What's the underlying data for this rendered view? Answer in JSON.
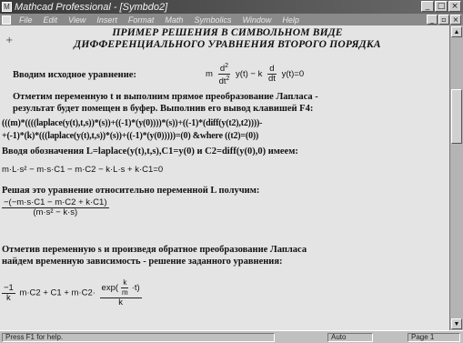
{
  "window": {
    "title": "Mathcad Professional - [Symbdo2]"
  },
  "menubar": {
    "items": [
      "File",
      "Edit",
      "View",
      "Insert",
      "Format",
      "Math",
      "Symbolics",
      "Window",
      "Help"
    ]
  },
  "document": {
    "heading_1": "ПРИМЕР РЕШЕНИЯ В СИМВОЛЬНОМ ВИДЕ",
    "heading_2": "ДИФФЕРЕНЦИАЛЬНОГО УРАВНЕНИЯ ВТОРОГО ПОРЯДКА",
    "input_label": "Вводим исходное уравнение:",
    "equation": {
      "m": "m",
      "d2": "d",
      "sq": "2",
      "dt2": "dt",
      "yt": "y(t)",
      "minus_k": "− k",
      "d1": "d",
      "dt1": "dt",
      "yt2": "y(t)",
      "eq": "=0"
    },
    "para_1a": "Отметим переменную t и выполним прямое преобразование Лапласа -",
    "para_1b": "результат будет помещен в буфер. Выполнив его вывод клавишей F4:",
    "laplace_1": "(((m)*((((laplace(y(t),t,s))*(s))+((-1)*(y(0))))*(s))+((-1)*(diff(y(t2),t2))))-",
    "laplace_2": "+(-1)*(k)*(((laplace(y(t),t,s))*(s))+((-1)*(y(0)))))=(0) &where ((t2)=(0))",
    "para_2": "Вводя обозначения L=laplace(y(t),t,s),C1=y(0) и C2=diff(y(0),0) имеем:",
    "expr_1": "m·L·s² − m·s·C1 − m·C2 − k·L·s + k·C1=0",
    "para_3": "Решая это уравнение относительно переменной L получим:",
    "sol_num": "−(−m·s·C1 − m·C2 + k·C1)",
    "sol_den": "(m·s² − k·s)",
    "para_4a": "Отметив переменную s и произведя обратное преобразование Лапласа",
    "para_4b": "найдем временную зависимость - решение заданного уравнения:",
    "final": {
      "neg1": "−1",
      "k1": "k",
      "mid": "m·C2 + C1 + m·C2·",
      "exp": "exp",
      "kt": "k",
      "mt": "m",
      "t": "·t",
      "k2": "k"
    }
  },
  "statusbar": {
    "help": "Press F1 for help.",
    "mode": "Auto",
    "page": "Page 1"
  }
}
